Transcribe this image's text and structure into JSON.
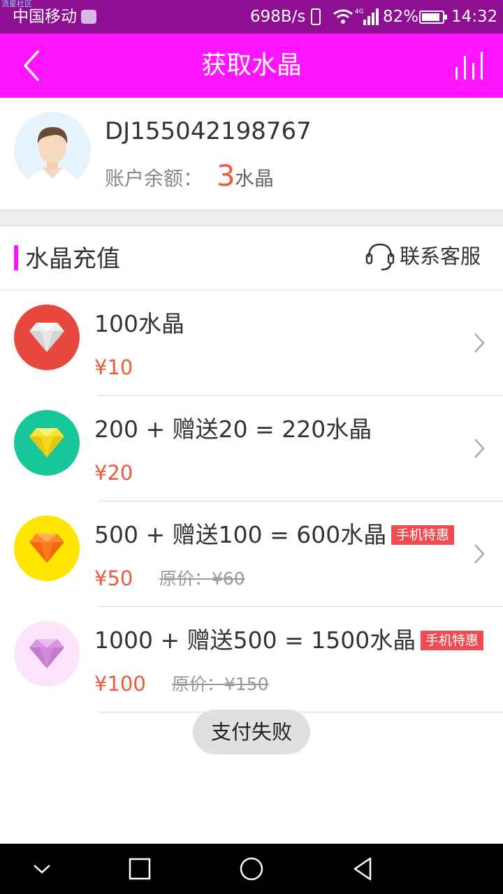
{
  "status_bar": {
    "watermark": "流星社区",
    "carrier": "中国移动",
    "speed": "698B/s",
    "network": "4G",
    "battery": "82%",
    "time": "14:32"
  },
  "header": {
    "title": "获取水晶",
    "back_icon": "chevron-left-icon",
    "stats_icon": "bar-chart-icon"
  },
  "account": {
    "user_id": "DJ155042198767",
    "balance_label": "账户余额：",
    "balance_value": "3",
    "balance_unit": "水晶"
  },
  "section": {
    "title": "水晶充值",
    "contact_label": "联系客服",
    "accent": "#ff14ff"
  },
  "packages": [
    {
      "title": "100水晶",
      "price": "¥10",
      "original_price": "",
      "badge": "",
      "icon": "diamond-icon-white",
      "icon_bg": "#e8473d"
    },
    {
      "title": "200 + 赠送20 = 220水晶",
      "price": "¥20",
      "original_price": "",
      "badge": "",
      "icon": "diamond-icon-yellow",
      "icon_bg": "#17c79a"
    },
    {
      "title": "500 + 赠送100 = 600水晶",
      "price": "¥50",
      "original_price": "原价：¥60",
      "badge": "手机特惠",
      "icon": "diamond-icon-orange",
      "icon_bg": "#ffe600"
    },
    {
      "title": "1000 + 赠送500 = 1500水晶",
      "price": "¥100",
      "original_price": "原价：¥150",
      "badge": "手机特惠",
      "icon": "diamond-icon-purple",
      "icon_bg": "#fde3fb"
    }
  ],
  "toast": "支付失败",
  "colors": {
    "status_bar": "#8e0f91",
    "header": "#ff14ff",
    "price": "#f05a3a",
    "badge": "#f04b53"
  }
}
